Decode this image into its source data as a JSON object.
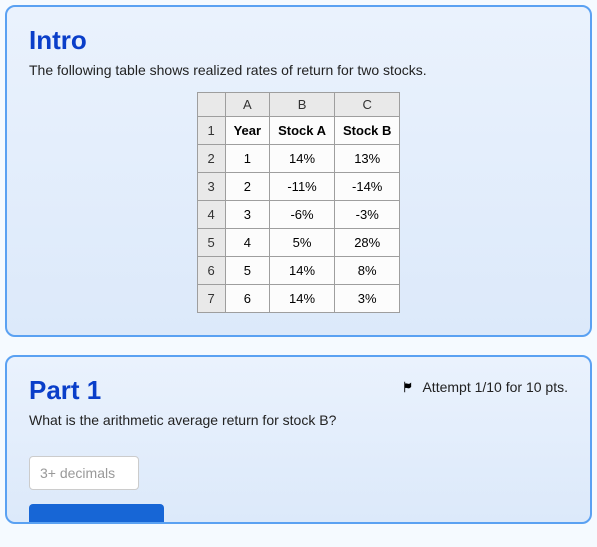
{
  "intro": {
    "title": "Intro",
    "desc": "The following table shows realized rates of return for two stocks."
  },
  "chart_data": {
    "type": "table",
    "columns": [
      "A",
      "B",
      "C"
    ],
    "header_row": {
      "row_num": "1",
      "A": "Year",
      "B": "Stock A",
      "C": "Stock B"
    },
    "rows": [
      {
        "row_num": "2",
        "A": "1",
        "B": "14%",
        "C": "13%"
      },
      {
        "row_num": "3",
        "A": "2",
        "B": "-11%",
        "C": "-14%"
      },
      {
        "row_num": "4",
        "A": "3",
        "B": "-6%",
        "C": "-3%"
      },
      {
        "row_num": "5",
        "A": "4",
        "B": "5%",
        "C": "28%"
      },
      {
        "row_num": "6",
        "A": "5",
        "B": "14%",
        "C": "8%"
      },
      {
        "row_num": "7",
        "A": "6",
        "B": "14%",
        "C": "3%"
      }
    ]
  },
  "part1": {
    "title": "Part 1",
    "attempt": "Attempt 1/10 for 10 pts.",
    "question": "What is the arithmetic average return for stock B?",
    "placeholder": "3+ decimals"
  }
}
